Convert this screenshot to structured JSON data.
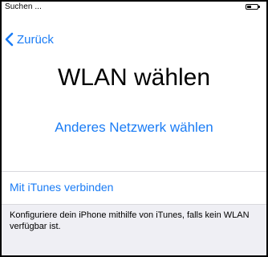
{
  "status_bar": {
    "carrier": "Suchen ...",
    "battery_icon": "battery-low-icon"
  },
  "nav": {
    "back_label": "Zurück",
    "back_icon": "chevron-left-icon"
  },
  "main": {
    "title": "WLAN wählen",
    "other_network_label": "Anderes Netzwerk wählen"
  },
  "itunes": {
    "link_label": "Mit iTunes verbinden",
    "description": "Konfiguriere dein iPhone mithilfe von iTunes, falls kein WLAN verfügbar ist."
  },
  "colors": {
    "accent": "#1a7cf5",
    "footer_background": "#efeff4"
  }
}
